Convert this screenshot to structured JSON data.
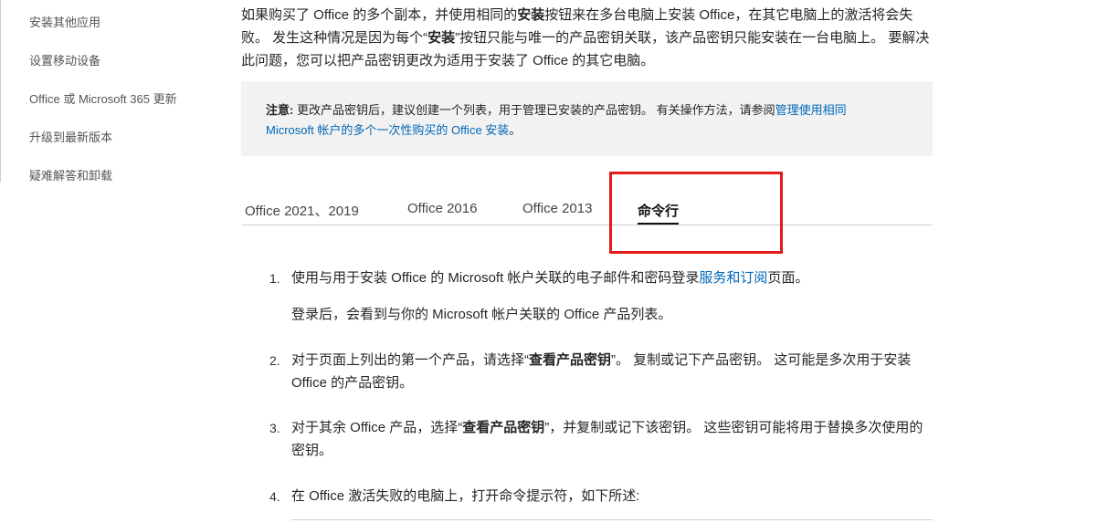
{
  "sidebar": {
    "items": [
      {
        "label": "安装其他应用"
      },
      {
        "label": "设置移动设备"
      },
      {
        "label": "Office 或 Microsoft 365 更新"
      },
      {
        "label": "升级到最新版本"
      },
      {
        "label": "疑难解答和卸载"
      }
    ]
  },
  "intro": {
    "p1": "如果购买了 Office 的多个副本，并使用相同的",
    "bold1": "安装",
    "p2": "按钮来在多台电脑上安装 Office，在其它电脑上的激活将会失败。 发生这种情况是因为每个“",
    "bold2": "安装",
    "p3": "”按钮只能与唯一的产品密钥关联，该产品密钥只能安装在一台电脑上。 要解决此问题，您可以把产品密钥更改为适用于安装了 Office 的其它电脑。"
  },
  "note": {
    "label": "注意:",
    "text": " 更改产品密钥后，建议创建一个列表，用于管理已安装的产品密钥。 有关操作方法，请参阅",
    "link": "管理使用相同 Microsoft 帐户的多个一次性购买的 Office 安装",
    "tail": "。"
  },
  "tabs": [
    {
      "label": "Office 2021、2019"
    },
    {
      "label": "Office 2016"
    },
    {
      "label": "Office 2013"
    },
    {
      "label": "命令行"
    }
  ],
  "steps": [
    {
      "num": "1.",
      "pre": "使用与用于安装 Office 的 Microsoft 帐户关联的电子邮件和密码登录",
      "link": "服务和订阅",
      "post": "页面。",
      "sub": "登录后，会看到与你的 Microsoft 帐户关联的 Office 产品列表。"
    },
    {
      "num": "2.",
      "pre": "对于页面上列出的第一个产品，请选择“",
      "bold": "查看产品密钥",
      "post": "”。 复制或记下产品密钥。 这可能是多次用于安装 Office 的产品密钥。"
    },
    {
      "num": "3.",
      "pre": "对于其余 Office 产品，选择“",
      "bold": "查看产品密钥",
      "post": "”，并复制或记下该密钥。 这些密钥可能将用于替换多次使用的密钥。"
    },
    {
      "num": "4.",
      "pre": "在 Office 激活失败的电脑上，打开命令提示符，如下所述:"
    }
  ],
  "colors": {
    "link": "#0067b8",
    "highlight": "#e21b1b",
    "note_bg": "#f2f2f2"
  }
}
